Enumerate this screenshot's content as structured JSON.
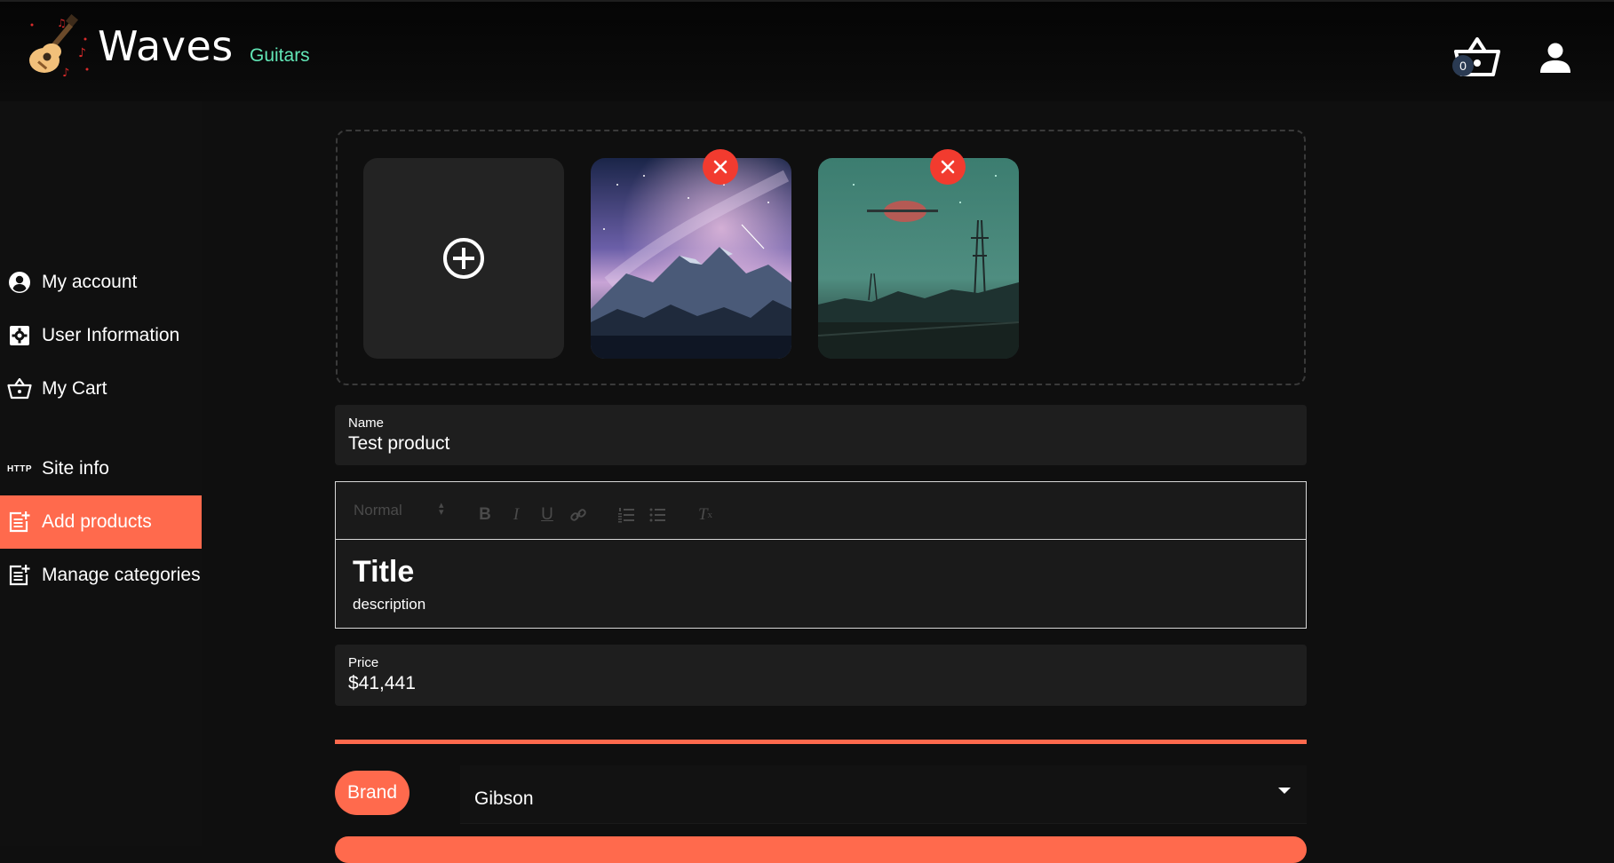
{
  "header": {
    "logo_text": "Waves",
    "nav_link": "Guitars",
    "cart_count": "0"
  },
  "sidebar": {
    "items": [
      {
        "label": "My account",
        "icon": "account-circle-icon"
      },
      {
        "label": "User Information",
        "icon": "settings-box-icon"
      },
      {
        "label": "My Cart",
        "icon": "basket-icon"
      },
      {
        "label": "Site info",
        "icon": "http-icon"
      },
      {
        "label": "Add products",
        "icon": "post-add-icon",
        "active": true
      },
      {
        "label": "Manage categories",
        "icon": "post-add-icon"
      }
    ]
  },
  "form": {
    "name_label": "Name",
    "name_value": "Test product",
    "editor": {
      "format_select": "Normal",
      "title": "Title",
      "description": "description"
    },
    "price_label": "Price",
    "price_value": "$41,441",
    "brand_label": "Brand",
    "brand_value": "Gibson"
  },
  "colors": {
    "accent": "#ff6a4d",
    "link": "#62e6b6",
    "remove": "#f23b2f"
  }
}
